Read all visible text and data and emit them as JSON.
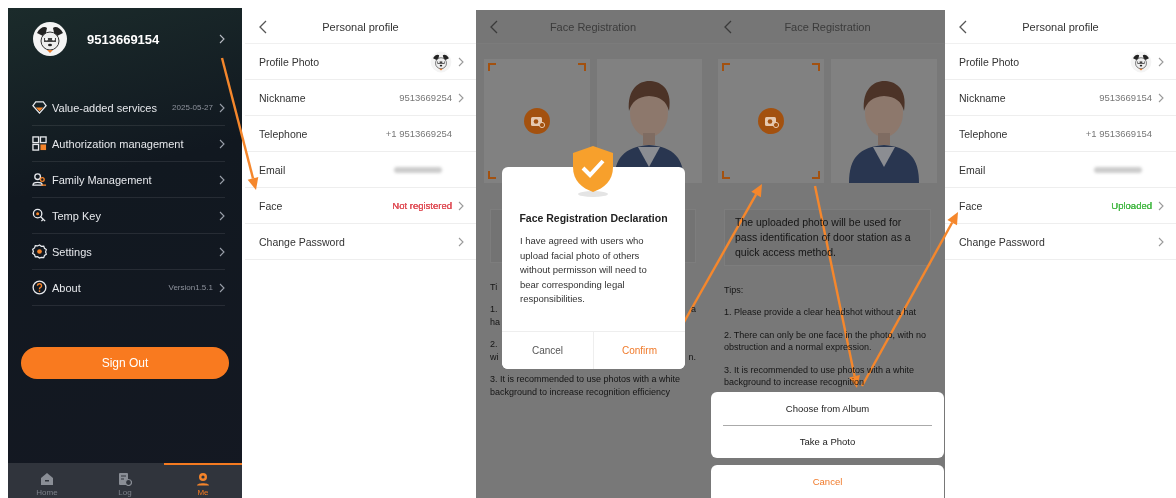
{
  "screens": [
    {
      "kind": "me",
      "account": "9513669154",
      "menu": [
        {
          "label": "Value-added services",
          "value": "2025-05-27"
        },
        {
          "label": "Authorization management"
        },
        {
          "label": "Family Management"
        },
        {
          "label": "Temp Key"
        },
        {
          "label": "Settings"
        },
        {
          "label": "About",
          "value": "Version1.5.1"
        }
      ],
      "sign_out": "Sign Out",
      "tabs": [
        {
          "label": "Home",
          "selected": false
        },
        {
          "label": "Log",
          "selected": false
        },
        {
          "label": "Me",
          "selected": true
        }
      ]
    },
    {
      "kind": "profile",
      "title": "Personal profile",
      "rows": [
        {
          "kind": "photo",
          "label": "Profile Photo",
          "chevron": true
        },
        {
          "kind": "text",
          "label": "Nickname",
          "value": "9513669254",
          "chevron": true
        },
        {
          "kind": "text",
          "label": "Telephone",
          "value": "+1 9513669254",
          "chevron": false
        },
        {
          "kind": "blurred",
          "label": "Email",
          "chevron": false
        },
        {
          "kind": "text",
          "label": "Face",
          "value": "Not registered",
          "color": "#e0525a",
          "chevron": true
        },
        {
          "kind": "text",
          "label": "Change Password",
          "chevron": true
        }
      ]
    },
    {
      "kind": "face_registration",
      "title": "Face Registration",
      "tips_title": "Ti",
      "partial_tips": [
        {
          "lines": [
            {
              "start": "1.",
              "end": "a"
            },
            {
              "start": "ha"
            }
          ]
        },
        {
          "lines": [
            {
              "start": "2."
            },
            {
              "start": "wi",
              "end": "n."
            }
          ]
        }
      ],
      "tips": [
        "3. It is recommended to use photos with a white background to increase recognition efficiency"
      ],
      "dialog": {
        "title": "Face Registration Declaration",
        "body": "I have agreed with users who upload facial photo of others without permisson will need to bear corresponding legal responsibilities.",
        "buttons": [
          {
            "label": "Cancel",
            "primary": false
          },
          {
            "label": "Confirm",
            "primary": true
          }
        ]
      }
    },
    {
      "kind": "face_registration",
      "title": "Face Registration",
      "note": "The uploaded photo will be used for pass identification of door station as a quick access method.",
      "tips_title": "Tips:",
      "tips": [
        "1. Please provide a clear headshot without a hat",
        "2. There can only be one face in the photo, with no obstruction and a normal expression.",
        "3. It is recommended to use photos with a white background to increase recognition"
      ],
      "action_sheet": {
        "options": [
          "Choose from Album",
          "Take a Photo"
        ],
        "cancel": "Cancel"
      }
    },
    {
      "kind": "profile",
      "title": "Personal profile",
      "rows": [
        {
          "kind": "photo",
          "label": "Profile Photo",
          "chevron": true
        },
        {
          "kind": "text",
          "label": "Nickname",
          "value": "9513669154",
          "chevron": true
        },
        {
          "kind": "text",
          "label": "Telephone",
          "value": "+1 9513669154",
          "chevron": false
        },
        {
          "kind": "blurred",
          "label": "Email",
          "chevron": false
        },
        {
          "kind": "text",
          "label": "Face",
          "value": "Uploaded",
          "color": "#4cbb4c",
          "chevron": true
        },
        {
          "kind": "text",
          "label": "Change Password",
          "chevron": true
        }
      ]
    }
  ]
}
